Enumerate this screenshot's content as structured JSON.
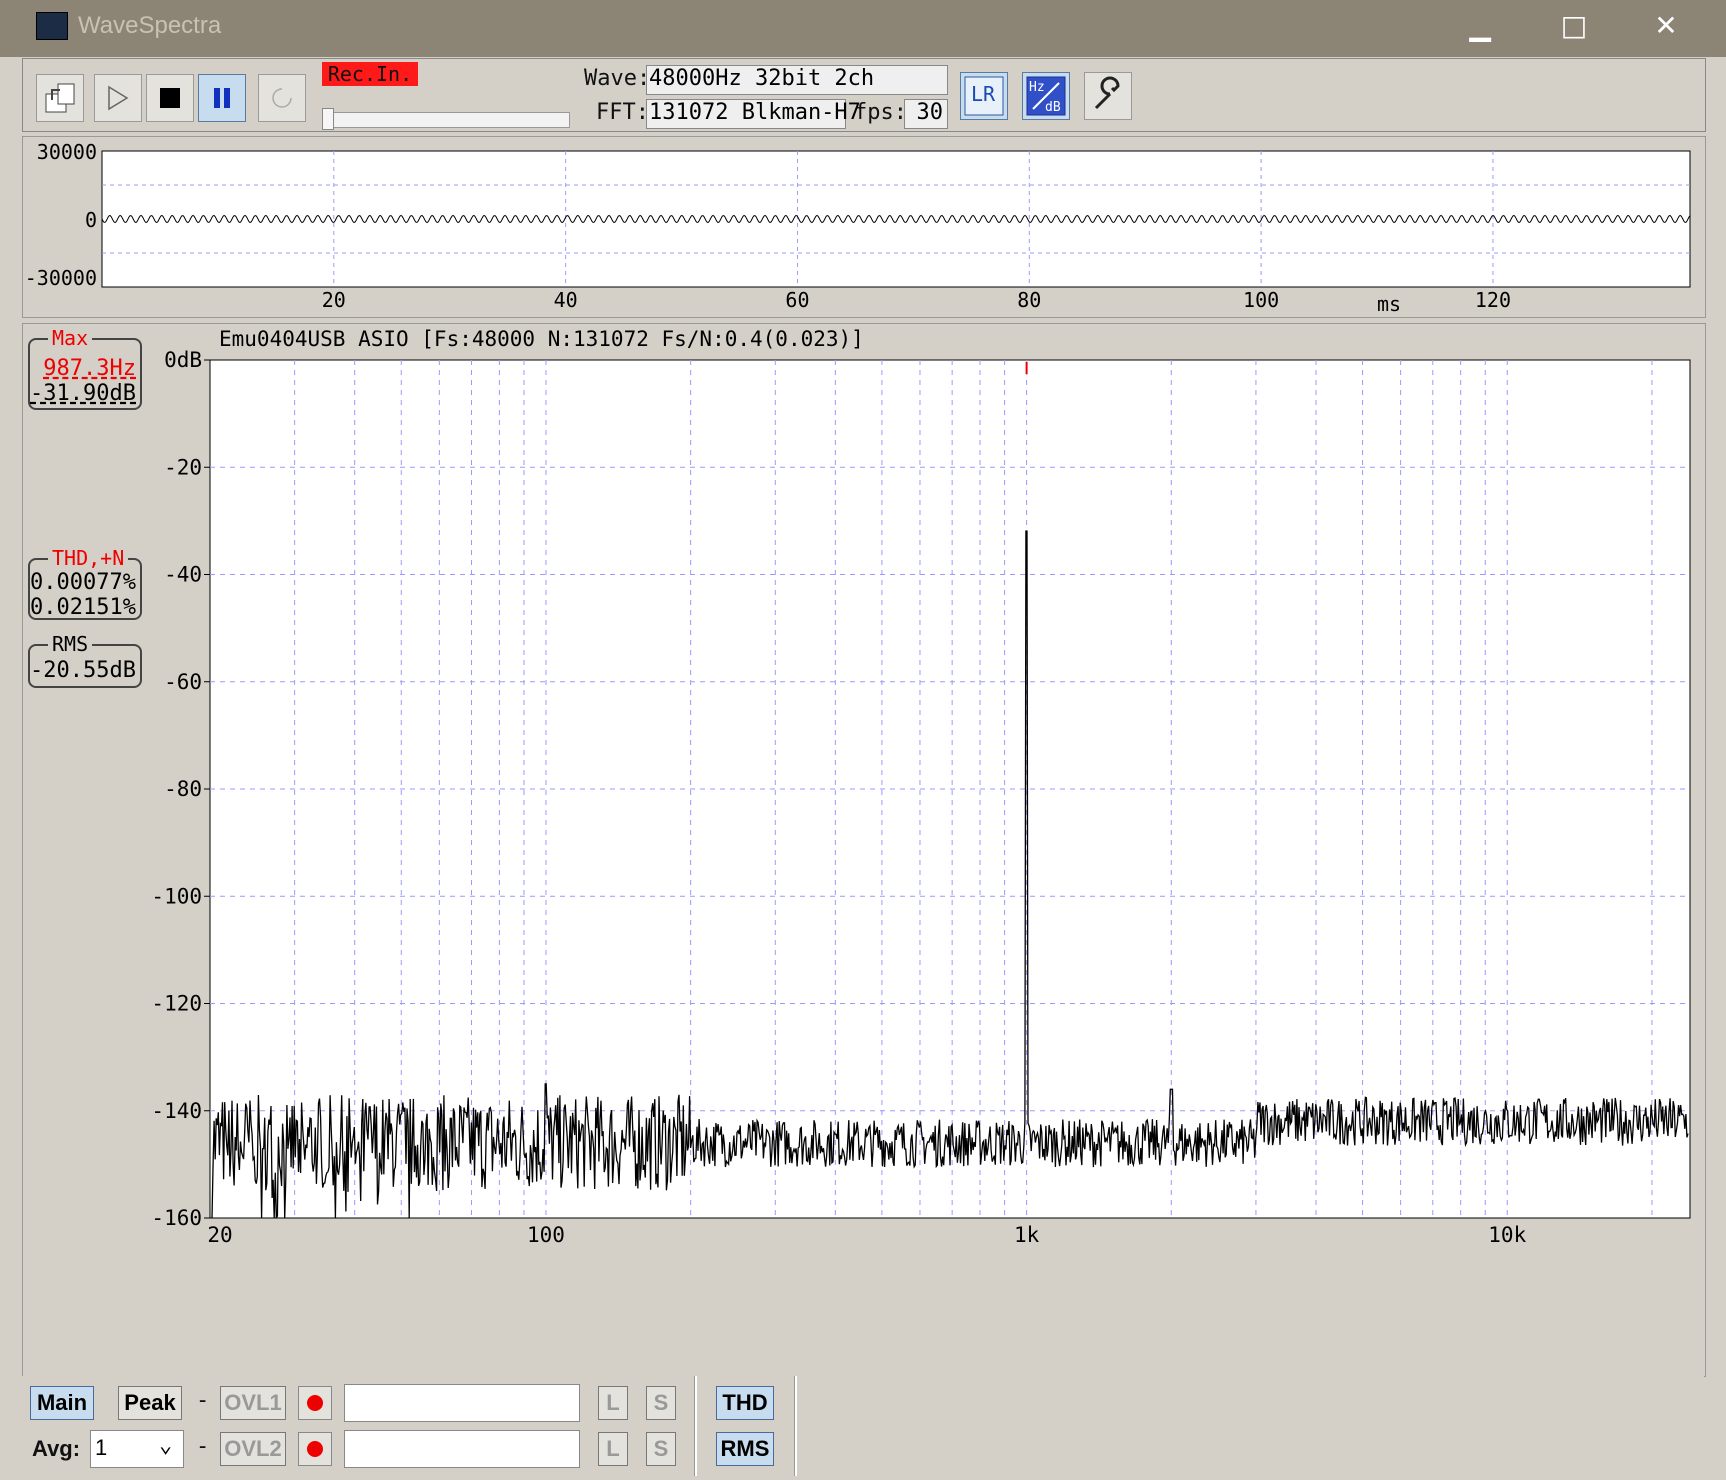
{
  "window": {
    "title": "WaveSpectra",
    "minimize": "▁",
    "maximize": "□",
    "close": "✕"
  },
  "toolbar": {
    "rec_label": "Rec.In.",
    "wave_label": "Wave:",
    "wave_value": "48000Hz 32bit 2ch",
    "fft_label": "FFT:",
    "fft_value": "131072 Blkman-H7",
    "fps_label": "fps:",
    "fps_value": "30",
    "icons": [
      "open-file-icon",
      "play-icon",
      "stop-icon",
      "pause-icon",
      "refresh-icon",
      "lr-channel-icon",
      "hz-db-scale-icon",
      "settings-wrench-icon"
    ],
    "lr_text": "LR",
    "hz_text": "Hz",
    "db_text": "dB"
  },
  "wave_chart": {
    "type": "line",
    "y_ticks": [
      "30000",
      "0",
      "-30000"
    ],
    "ylim": [
      -30000,
      30000
    ],
    "x_ticks": [
      "20",
      "40",
      "60",
      "80",
      "100",
      "120"
    ],
    "x_tick_values": [
      20,
      40,
      60,
      80,
      100,
      120
    ],
    "xlim": [
      0,
      137
    ],
    "xunit": "ms",
    "grid": true
  },
  "fft_info": {
    "header": "Emu0404USB ASIO   [Fs:48000 N:131072 Fs/N:0.4(0.023)]",
    "max_caption": "Max",
    "max_freq": "987.3Hz",
    "max_db": "-31.90dB",
    "thd_caption": "THD,+N",
    "thd_value": "0.00077%",
    "thdn_value": "0.02151%",
    "rms_caption": "RMS",
    "rms_value": "-20.55dB"
  },
  "chart_data": {
    "type": "line",
    "title": "Emu0404USB ASIO   [Fs:48000 N:131072 Fs/N:0.4(0.023)]",
    "x_scale": "log",
    "xlim": [
      20,
      24000
    ],
    "ylim": [
      -160,
      0
    ],
    "y_ticks": [
      "0dB",
      "-20",
      "-40",
      "-60",
      "-80",
      "-100",
      "-120",
      "-140",
      "-160"
    ],
    "x_ticks": [
      "20",
      "100",
      "1k",
      "10k"
    ],
    "grid": true,
    "peaks": [
      {
        "x": 1000,
        "y": -31.9
      },
      {
        "x": 100,
        "y": -135
      },
      {
        "x": 2000,
        "y": -136
      },
      {
        "x": 6000,
        "y": -140
      }
    ],
    "noise_floor": -146
  },
  "bottom": {
    "main": "Main",
    "peak": "Peak",
    "dash": "-",
    "ovl1": "OVL1",
    "ovl2": "OVL2",
    "l": "L",
    "s": "S",
    "thd": "THD",
    "rms": "RMS",
    "avg_label": "Avg:",
    "avg_value": "1"
  }
}
